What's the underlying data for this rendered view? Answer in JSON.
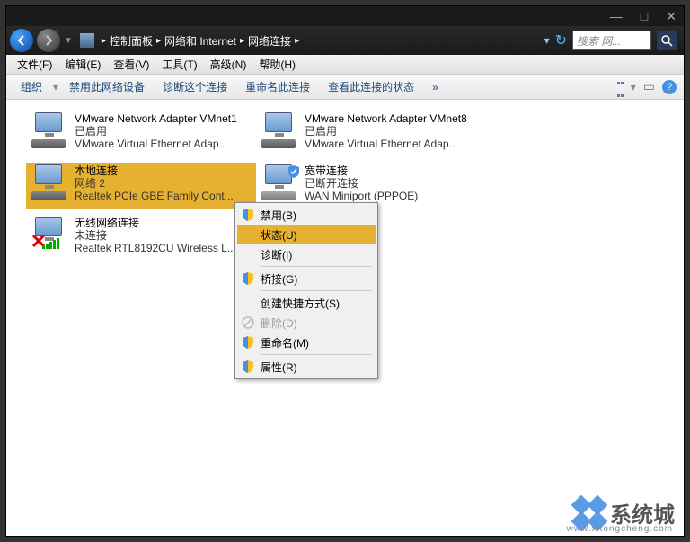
{
  "titlebar": {
    "min": "—",
    "max": "□",
    "close": "✕"
  },
  "breadcrumb": {
    "seg1": "控制面板",
    "seg2": "网络和 Internet",
    "seg3": "网络连接"
  },
  "nav": {
    "dropdown": "▾",
    "refresh": "↻"
  },
  "search": {
    "placeholder": "搜索 网...",
    "icon": "🔍"
  },
  "menubar": {
    "file": "文件(F)",
    "edit": "编辑(E)",
    "view": "查看(V)",
    "tools": "工具(T)",
    "advanced": "高级(N)",
    "help": "帮助(H)"
  },
  "toolbar": {
    "organize": "组织",
    "disable": "禁用此网络设备",
    "diagnose": "诊断这个连接",
    "rename": "重命名此连接",
    "status": "查看此连接的状态",
    "more": "»"
  },
  "connections": [
    {
      "name": "VMware Network Adapter VMnet1",
      "status": "已启用",
      "device": "VMware Virtual Ethernet Adap..."
    },
    {
      "name": "VMware Network Adapter VMnet8",
      "status": "已启用",
      "device": "VMware Virtual Ethernet Adap..."
    },
    {
      "name": "本地连接",
      "status": "网络  2",
      "device": "Realtek PCIe GBE Family Cont..."
    },
    {
      "name": "宽带连接",
      "status": "已断开连接",
      "device": "WAN Miniport (PPPOE)"
    },
    {
      "name": "无线网络连接",
      "status": "未连接",
      "device": "Realtek RTL8192CU Wireless L..."
    }
  ],
  "ctxmenu": {
    "disable": "禁用(B)",
    "status": "状态(U)",
    "diagnose": "诊断(I)",
    "bridge": "桥接(G)",
    "shortcut": "创建快捷方式(S)",
    "delete": "删除(D)",
    "rename": "重命名(M)",
    "props": "属性(R)"
  },
  "watermark": {
    "text": "系统城",
    "sub": "www.xitongcheng.com"
  }
}
